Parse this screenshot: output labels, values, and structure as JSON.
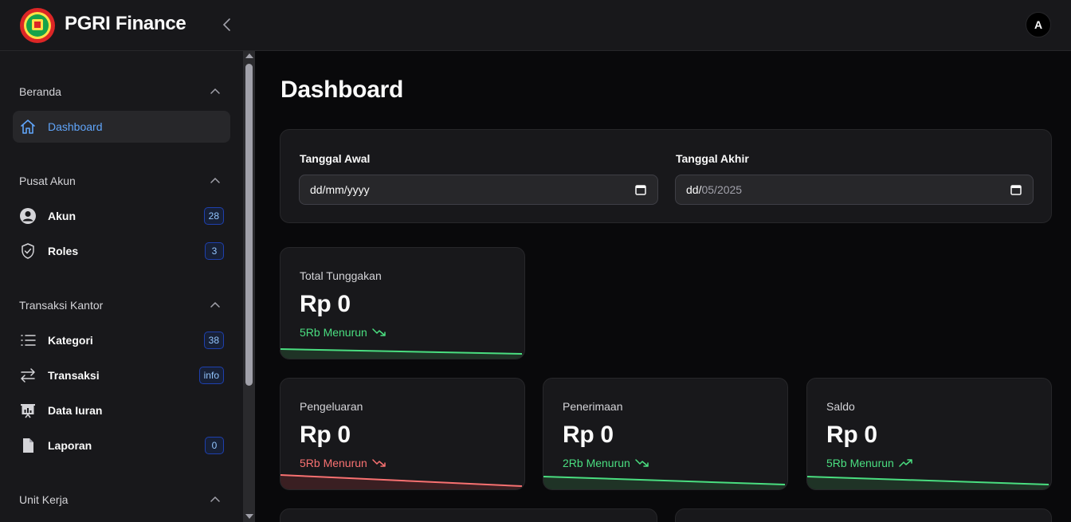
{
  "header": {
    "app_title": "PGRI Finance",
    "avatar_initial": "A",
    "logo_icon": "pgri-logo",
    "collapse_icon": "chevron-left-icon"
  },
  "sidebar": {
    "groups": [
      {
        "title": "Beranda",
        "items": [
          {
            "label": "Dashboard",
            "icon": "home-icon",
            "active": true
          }
        ]
      },
      {
        "title": "Pusat Akun",
        "items": [
          {
            "label": "Akun",
            "icon": "user-circle-icon",
            "badge": "28"
          },
          {
            "label": "Roles",
            "icon": "shield-check-icon",
            "badge": "3"
          }
        ]
      },
      {
        "title": "Transaksi Kantor",
        "items": [
          {
            "label": "Kategori",
            "icon": "list-icon",
            "badge": "38"
          },
          {
            "label": "Transaksi",
            "icon": "arrows-exchange-icon",
            "badge": "info"
          },
          {
            "label": "Data Iuran",
            "icon": "presentation-chart-icon"
          },
          {
            "label": "Laporan",
            "icon": "document-icon",
            "badge": "0"
          }
        ]
      },
      {
        "title": "Unit Kerja",
        "items": []
      }
    ]
  },
  "main": {
    "page_title": "Dashboard",
    "filters": {
      "start_label": "Tanggal Awal",
      "start_value": "dd/mm/yyyy",
      "end_label": "Tanggal Akhir",
      "end_value_day": "dd/",
      "end_value_month": "05/",
      "end_value_year": "2025"
    },
    "stats": [
      {
        "label": "Total Tunggakan",
        "value": "Rp 0",
        "trend": "5Rb Menurun",
        "trend_color": "#4ade80",
        "trend_icon": "trending-down-icon"
      },
      {
        "label": "Pengeluaran",
        "value": "Rp 0",
        "trend": "5Rb Menurun",
        "trend_color": "#f87171",
        "trend_icon": "trending-down-icon"
      },
      {
        "label": "Penerimaan",
        "value": "Rp 0",
        "trend": "2Rb Menurun",
        "trend_color": "#4ade80",
        "trend_icon": "trending-down-icon"
      },
      {
        "label": "Saldo",
        "value": "Rp 0",
        "trend": "5Rb Menurun",
        "trend_color": "#4ade80",
        "trend_icon": "trending-up-icon"
      }
    ]
  },
  "colors": {
    "background": "#09090b",
    "surface": "#18181b",
    "accent_blue": "#60a5fa",
    "positive": "#4ade80",
    "negative": "#f87171"
  }
}
